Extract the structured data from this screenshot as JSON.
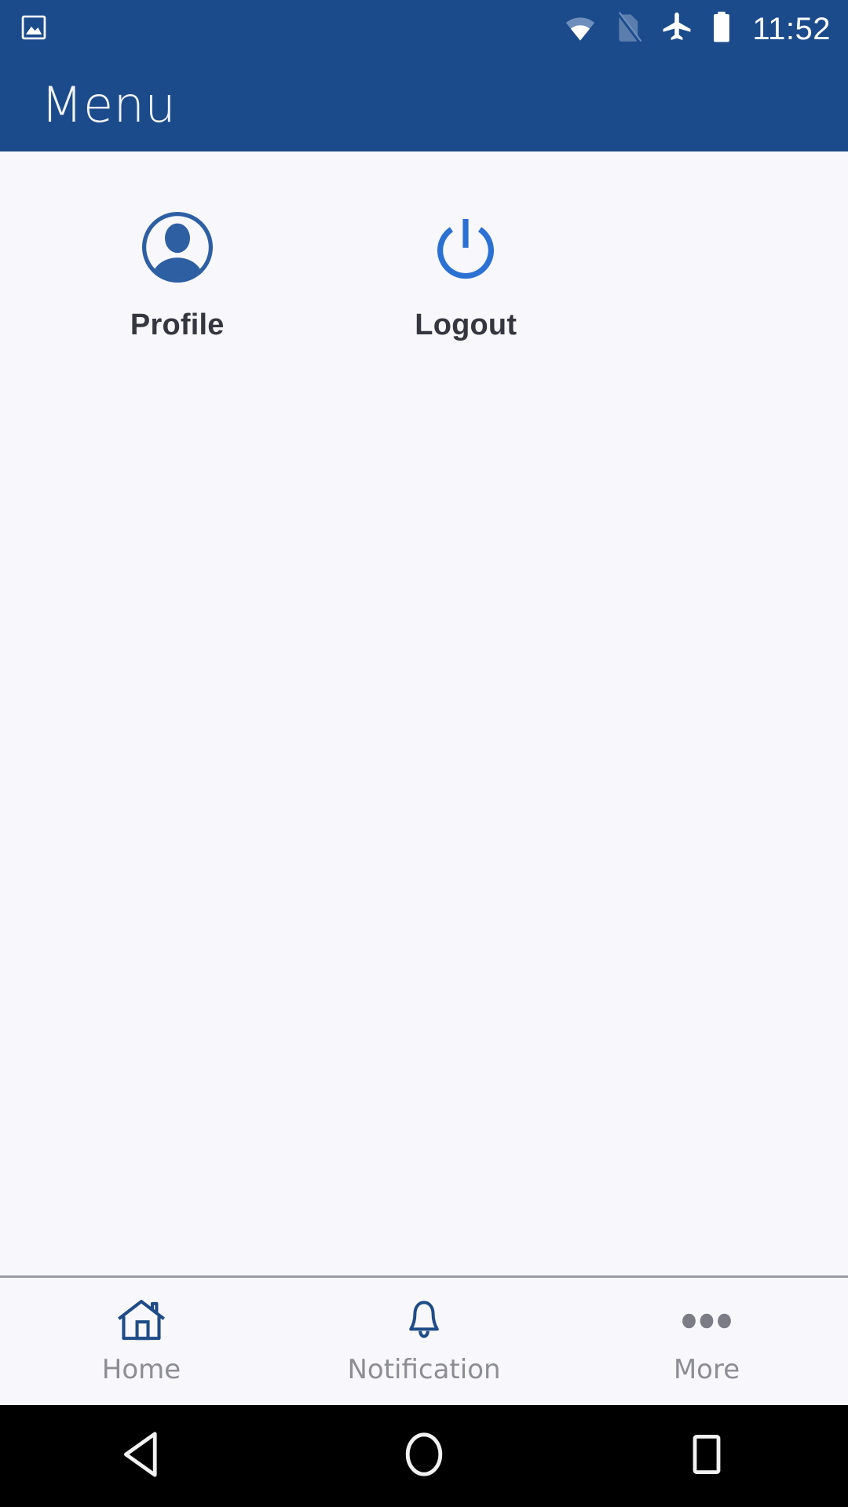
{
  "status_bar": {
    "notification_icon": "image-icon",
    "icons": [
      "wifi-icon",
      "no-sim-icon",
      "airplane-mode-icon",
      "battery-icon"
    ],
    "time": "11:52"
  },
  "app_bar": {
    "title": "Menu",
    "background_color": "#1C4B8C",
    "title_color": "#F2F5F9"
  },
  "content": {
    "background_color": "#F7F7FC",
    "items": [
      {
        "label": "Profile",
        "icon": "user-circle-icon",
        "color": "#2E5FA3"
      },
      {
        "label": "Logout",
        "icon": "power-icon",
        "color": "#2B71D4"
      }
    ]
  },
  "tab_bar": {
    "icon_color": "#1F4C87",
    "label_color": "#8d8d94",
    "tabs": [
      {
        "label": "Home",
        "icon": "home-icon"
      },
      {
        "label": "Notification",
        "icon": "bell-icon"
      },
      {
        "label": "More",
        "icon": "more-dots-icon"
      }
    ]
  },
  "nav_bar": {
    "background_color": "#000000",
    "buttons": [
      {
        "name": "back-button",
        "icon": "triangle-left-icon"
      },
      {
        "name": "home-button",
        "icon": "circle-icon"
      },
      {
        "name": "recents-button",
        "icon": "square-icon"
      }
    ]
  }
}
